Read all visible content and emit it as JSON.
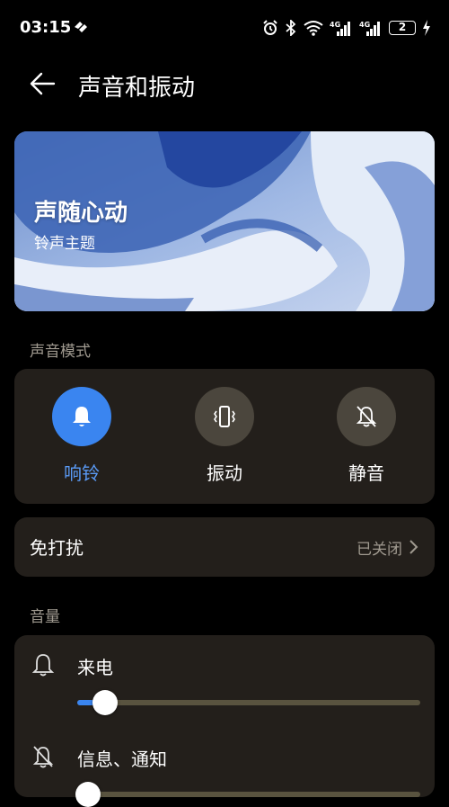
{
  "status_bar": {
    "time": "03:15",
    "battery": "2",
    "icons": [
      "alarm-icon",
      "bluetooth-icon",
      "wifi-icon",
      "signal-4g-icon",
      "signal-4g-icon",
      "battery-icon",
      "charging-icon"
    ]
  },
  "header": {
    "title": "声音和振动",
    "back_icon": "back-arrow-icon"
  },
  "banner": {
    "title": "声随心动",
    "subtitle": "铃声主题"
  },
  "sound_mode": {
    "section_label": "声音模式",
    "modes": [
      {
        "label": "响铃",
        "icon": "bell-icon",
        "active": true
      },
      {
        "label": "振动",
        "icon": "vibrate-icon",
        "active": false
      },
      {
        "label": "静音",
        "icon": "bell-off-icon",
        "active": false
      }
    ]
  },
  "dnd": {
    "label": "免打扰",
    "value": "已关闭"
  },
  "volume": {
    "section_label": "音量",
    "items": [
      {
        "label": "来电",
        "icon": "bell-icon",
        "level": 0.05
      },
      {
        "label": "信息、通知",
        "icon": "bell-off-icon",
        "level": 0.0
      }
    ]
  },
  "colors": {
    "accent": "#3a85f0",
    "card": "#231f1b",
    "muted": "#a09a90"
  }
}
